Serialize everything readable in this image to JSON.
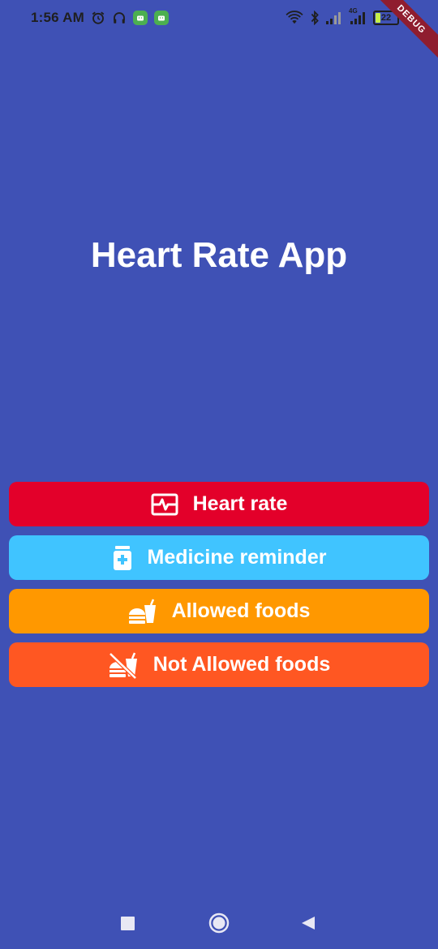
{
  "status_bar": {
    "time": "1:56 AM",
    "battery_level": "22",
    "network_label": "4G",
    "icons": [
      "alarm-icon",
      "headphones-icon",
      "android-app-icon",
      "android-app-icon",
      "wifi-icon",
      "bluetooth-icon",
      "signal-icon",
      "signal-icon",
      "battery-icon"
    ]
  },
  "debug_banner": "DEBUG",
  "title": "Heart Rate App",
  "menu": [
    {
      "label": "Heart rate",
      "icon": "heart-monitor-icon",
      "color": "#e3002a"
    },
    {
      "label": "Medicine reminder",
      "icon": "medicine-bottle-icon",
      "color": "#40c4ff"
    },
    {
      "label": "Allowed foods",
      "icon": "fastfood-icon",
      "color": "#ff9800"
    },
    {
      "label": "Not Allowed foods",
      "icon": "no-food-icon",
      "color": "#ff5722"
    }
  ],
  "nav": [
    "recents-icon",
    "home-icon",
    "back-icon"
  ]
}
